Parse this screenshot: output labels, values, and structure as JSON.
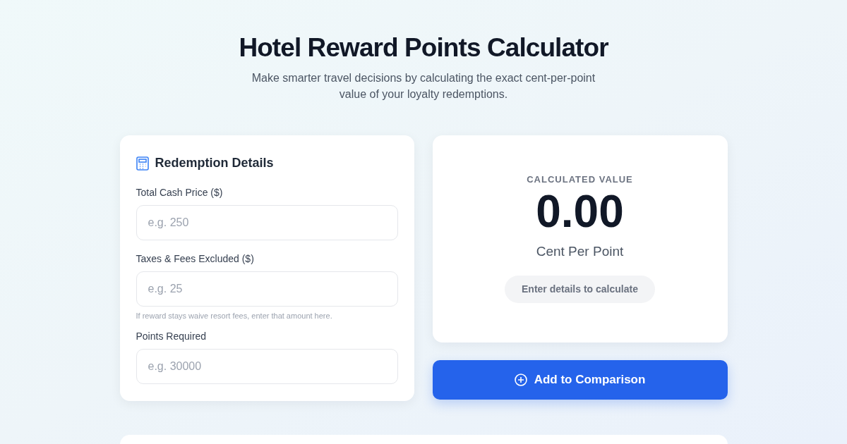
{
  "header": {
    "title": "Hotel Reward Points Calculator",
    "subtitle": "Make smarter travel decisions by calculating the exact cent-per-point value of your loyalty redemptions."
  },
  "form": {
    "title": "Redemption Details",
    "fields": [
      {
        "label": "Total Cash Price ($)",
        "placeholder": "e.g. 250"
      },
      {
        "label": "Taxes & Fees Excluded ($)",
        "placeholder": "e.g. 25",
        "hint": "If reward stays waive resort fees, enter that amount here."
      },
      {
        "label": "Points Required",
        "placeholder": "e.g. 30000"
      }
    ]
  },
  "result": {
    "caption": "CALCULATED VALUE",
    "value": "0.00",
    "unit": "Cent Per Point",
    "status": "Enter details to calculate"
  },
  "action": {
    "label": "Add to Comparison"
  }
}
